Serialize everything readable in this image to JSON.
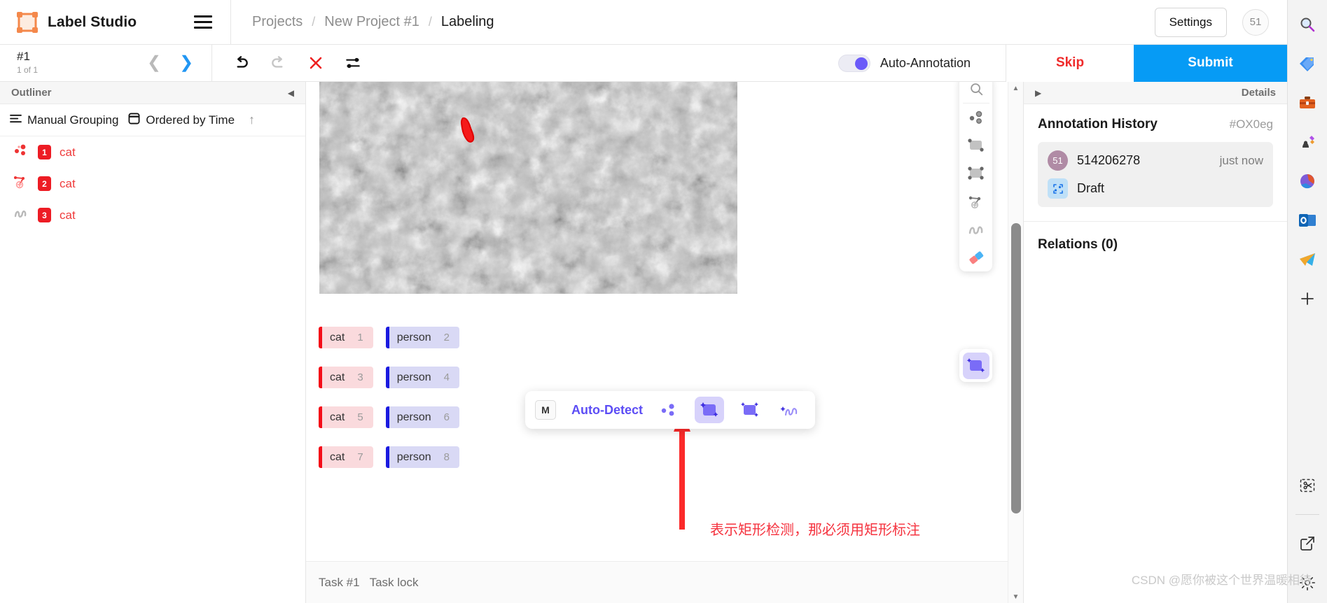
{
  "app": {
    "brand": "Label Studio",
    "logo_icon": "label-studio-logo-icon",
    "menu_icon": "hamburger-menu-icon"
  },
  "breadcrumb": {
    "items": [
      "Projects",
      "New Project #1",
      "Labeling"
    ],
    "separator": "/"
  },
  "topbar": {
    "settings_label": "Settings",
    "user_badge": "51"
  },
  "actionbar": {
    "task_id": "#1",
    "task_count": "1 of 1",
    "prev_icon": "chevron-left-icon",
    "next_icon": "chevron-right-icon",
    "undo_icon": "undo-icon",
    "redo_icon": "redo-icon",
    "reset_icon": "reset-close-icon",
    "settings_icon": "annotation-settings-icon",
    "auto_annotation_label": "Auto-Annotation",
    "auto_annotation_on": true,
    "skip_label": "Skip",
    "submit_label": "Submit"
  },
  "outliner": {
    "title": "Outliner",
    "collapse_icon": "collapse-left-icon",
    "grouping_label": "Manual Grouping",
    "grouping_icon": "grouping-icon",
    "order_label": "Ordered by Time",
    "order_icon": "ordered-by-time-icon",
    "sort_icon": "sort-ascending-icon",
    "regions": [
      {
        "index": "1",
        "label": "cat",
        "shape_icon": "keypoints-icon"
      },
      {
        "index": "2",
        "label": "cat",
        "shape_icon": "polygon-icon"
      },
      {
        "index": "3",
        "label": "cat",
        "shape_icon": "brush-icon"
      }
    ]
  },
  "canvas": {
    "image_alt": "grayscale-noise-texture-image",
    "region_color": "#ff0000"
  },
  "labels": {
    "rows": [
      [
        {
          "name": "cat",
          "hotkey": "1",
          "color": "#f40b18"
        },
        {
          "name": "person",
          "hotkey": "2",
          "color": "#1a1ae0"
        }
      ],
      [
        {
          "name": "cat",
          "hotkey": "3",
          "color": "#f40b18"
        },
        {
          "name": "person",
          "hotkey": "4",
          "color": "#1a1ae0"
        }
      ],
      [
        {
          "name": "cat",
          "hotkey": "5",
          "color": "#f40b18"
        },
        {
          "name": "person",
          "hotkey": "6",
          "color": "#1a1ae0"
        }
      ],
      [
        {
          "name": "cat",
          "hotkey": "7",
          "color": "#f40b18"
        },
        {
          "name": "person",
          "hotkey": "8",
          "color": "#1a1ae0"
        }
      ]
    ]
  },
  "auto_detect": {
    "hotkey": "M",
    "label": "Auto-Detect",
    "accent": "#5c4df5",
    "tools": [
      {
        "icon": "auto-keypoints-icon",
        "selected": false
      },
      {
        "icon": "auto-rectangle-icon",
        "selected": true
      },
      {
        "icon": "auto-polygon-icon",
        "selected": false
      },
      {
        "icon": "auto-brush-icon",
        "selected": false
      }
    ]
  },
  "tool_rail": {
    "tools": [
      {
        "icon": "zoom-icon"
      },
      {
        "icon": "keypoints-tool-icon"
      },
      {
        "icon": "rectangle-tool-icon"
      },
      {
        "icon": "rectangle-3pt-tool-icon"
      },
      {
        "icon": "polygon-tool-icon"
      },
      {
        "icon": "brush-tool-icon"
      },
      {
        "icon": "eraser-tool-icon"
      }
    ],
    "active_tool": {
      "icon": "magic-rectangle-tool-icon"
    }
  },
  "annotation_note": {
    "text": "表示矩形检测，那必须用矩形标注",
    "arrow_icon": "red-arrow-up-icon",
    "color": "#f5333f"
  },
  "task_footer": {
    "task_label": "Task #1",
    "lock_label": "Task lock"
  },
  "details": {
    "expand_icon": "expand-right-icon",
    "title": "Details",
    "history_title": "Annotation History",
    "history_id": "#OX0eg",
    "entry": {
      "avatar": "51",
      "user": "514206278",
      "time": "just now",
      "state_icon": "draft-icon",
      "state": "Draft"
    },
    "relations_title": "Relations (0)"
  },
  "edge_sidebar": {
    "icons": [
      "search-icon",
      "shopping-tag-icon",
      "toolbox-icon",
      "games-icon",
      "microsoft365-icon",
      "outlook-icon",
      "telegram-icon",
      "add-icon",
      "screenshot-icon",
      "open-external-icon",
      "gear-icon"
    ]
  },
  "watermark": {
    "text": "CSDN @愿你被这个世界温暖相待"
  }
}
